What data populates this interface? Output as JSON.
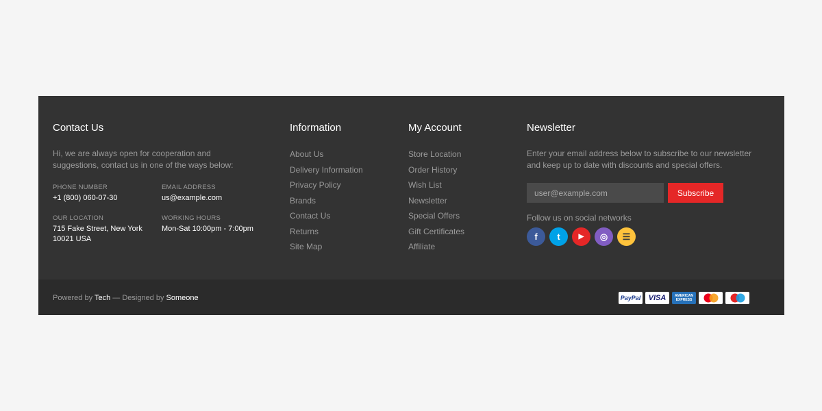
{
  "contact": {
    "title": "Contact Us",
    "intro": "Hi, we are always open for cooperation and suggestions, contact us in one of the ways below:",
    "items": [
      {
        "label": "Phone Number",
        "value": "+1 (800) 060-07-30"
      },
      {
        "label": "Email Address",
        "value": "us@example.com"
      },
      {
        "label": "Our Location",
        "value": "715 Fake Street, New York 10021 USA"
      },
      {
        "label": "Working Hours",
        "value": "Mon-Sat 10:00pm - 7:00pm"
      }
    ]
  },
  "information": {
    "title": "Information",
    "links": [
      "About Us",
      "Delivery Information",
      "Privacy Policy",
      "Brands",
      "Contact Us",
      "Returns",
      "Site Map"
    ]
  },
  "account": {
    "title": "My Account",
    "links": [
      "Store Location",
      "Order History",
      "Wish List",
      "Newsletter",
      "Special Offers",
      "Gift Certificates",
      "Affiliate"
    ]
  },
  "newsletter": {
    "title": "Newsletter",
    "intro": "Enter your email address below to subscribe to our newsletter and keep up to date with discounts and special offers.",
    "placeholder": "user@example.com",
    "button": "Subscribe",
    "follow": "Follow us on social networks",
    "social": [
      {
        "icon": "facebook-icon",
        "glyph": "f",
        "color": "#3c5a99"
      },
      {
        "icon": "twitter-icon",
        "glyph": "t",
        "color": "#00a2e8"
      },
      {
        "icon": "youtube-icon",
        "glyph": "▶",
        "color": "#e52727"
      },
      {
        "icon": "instagram-icon",
        "glyph": "◎",
        "color": "#815dc2"
      },
      {
        "icon": "rss-icon",
        "glyph": "☰",
        "color": "#ffc33c"
      }
    ]
  },
  "bottom": {
    "powered": "Powered by",
    "tech": "Tech",
    "designed": "— Designed by",
    "someone": "Someone",
    "payments": [
      "PayPal",
      "VISA",
      "AMERICAN EXPRESS",
      "Mastercard",
      "Maestro"
    ]
  }
}
